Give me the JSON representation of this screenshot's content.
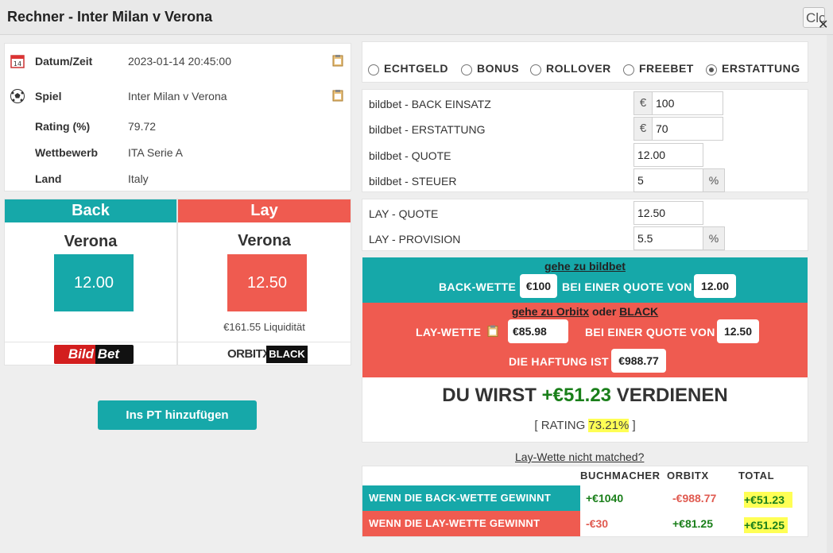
{
  "window": {
    "title": "Rechner - Inter Milan v Verona",
    "close_label": "Close"
  },
  "info": {
    "rows": [
      {
        "label": "Datum/Zeit",
        "value": "2023-01-14 20:45:00"
      },
      {
        "label": "Spiel",
        "value": "Inter Milan v Verona"
      },
      {
        "label": "Rating (%)",
        "value": "79.72"
      },
      {
        "label": "Wettbewerb",
        "value": "ITA Serie A"
      },
      {
        "label": "Land",
        "value": "Italy"
      }
    ]
  },
  "back": {
    "header": "Back",
    "team": "Verona",
    "odds": "12.00",
    "bookmaker_logo": "Bild Bet",
    "color": "#16a8a9"
  },
  "lay": {
    "header": "Lay",
    "team": "Verona",
    "odds": "12.50",
    "liquidity": "€161.55 Liquidität",
    "exchange_logo": "ORBITX",
    "exchange_logo2": "BLACK",
    "color": "#ef5b50"
  },
  "add_pt_label": "Ins PT hinzufügen",
  "bet_types": [
    {
      "label": "ECHTGELD",
      "selected": false
    },
    {
      "label": "BONUS",
      "selected": false
    },
    {
      "label": "ROLLOVER",
      "selected": false
    },
    {
      "label": "FREEBET",
      "selected": false
    },
    {
      "label": "ERSTATTUNG",
      "selected": true
    }
  ],
  "form": {
    "back_stake": {
      "label": "bildbet - BACK EINSATZ",
      "prefix": "€",
      "value": "100"
    },
    "refund": {
      "label": "bildbet - ERSTATTUNG",
      "prefix": "€",
      "value": "70"
    },
    "back_odds": {
      "label": "bildbet - QUOTE",
      "value": "12.00"
    },
    "tax": {
      "label": "bildbet - STEUER",
      "value": "5",
      "suffix": "%"
    },
    "lay_odds": {
      "label": "LAY - QUOTE",
      "value": "12.50"
    },
    "commission": {
      "label": "LAY - PROVISION",
      "value": "5.5",
      "suffix": "%"
    }
  },
  "calc": {
    "back_link": "gehe zu bildbet",
    "back_bet_label": "BACK-WETTE",
    "back_bet_amount": "€100",
    "at_odds_label": "BEI EINER QUOTE VON",
    "back_bet_odds": "12.00",
    "lay_link1": "gehe zu  Orbitx",
    "lay_link_or": "oder",
    "lay_link2": "BLACK",
    "lay_bet_label": "LAY-WETTE",
    "lay_bet_amount": "€85.98",
    "lay_bet_odds": "12.50",
    "liability_label": "DIE HAFTUNG IST",
    "liability_amount": "€988.77",
    "result_pre": "DU WIRST",
    "result_amount": "+€51.23",
    "result_post": "VERDIENEN",
    "rating_pre": "[ RATING",
    "rating_value": "73.21%",
    "rating_post": "]"
  },
  "not_matched_link": "Lay-Wette nicht matched?",
  "summary": {
    "headers": [
      "BUCHMACHER",
      "ORBITX",
      "TOTAL"
    ],
    "rows": [
      {
        "label": "WENN DIE BACK-WETTE GEWINNT",
        "bookmaker": "+€1040",
        "orbitx": "-€988.77",
        "total": "+€51.23"
      },
      {
        "label": "WENN DIE LAY-WETTE GEWINNT",
        "bookmaker": "-€30",
        "orbitx": "+€81.25",
        "total": "+€51.25"
      }
    ]
  }
}
